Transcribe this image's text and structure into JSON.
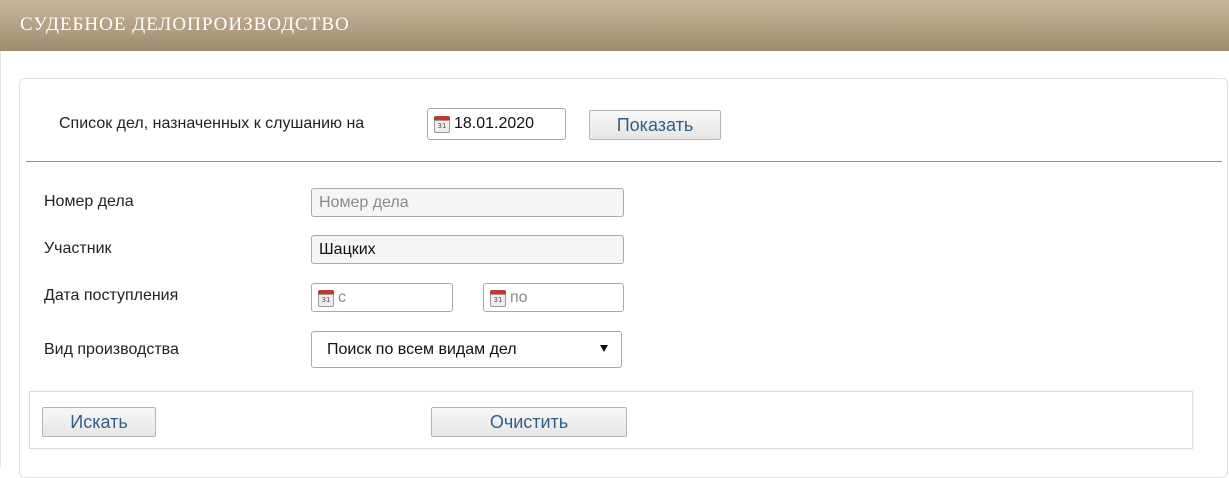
{
  "header": {
    "title": "СУДЕБНОЕ ДЕЛОПРОИЗВОДСТВО"
  },
  "schedule": {
    "label": "Список дел, назначенных к слушанию на",
    "date_value": "18.01.2020",
    "show_button": "Показать"
  },
  "form": {
    "case_number": {
      "label": "Номер дела",
      "placeholder": "Номер дела",
      "value": ""
    },
    "participant": {
      "label": "Участник",
      "value": "Шацких"
    },
    "receipt_date": {
      "label": "Дата поступления",
      "from_placeholder": "с",
      "to_placeholder": "по"
    },
    "proceeding_type": {
      "label": "Вид производства",
      "selected": "Поиск по всем видам дел"
    }
  },
  "actions": {
    "search_button": "Искать",
    "clear_button": "Очистить"
  },
  "icons": {
    "calendar": "calendar-icon",
    "dropdown": "chevron-down-icon"
  },
  "colors": {
    "header_bg": "#b29f84",
    "button_text": "#2f5f8a",
    "calendar_red": "#c0392b"
  }
}
